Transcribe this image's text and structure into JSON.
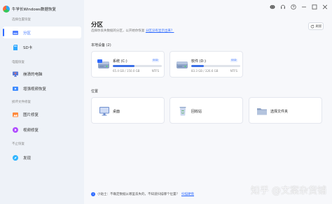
{
  "app": {
    "title": "牛学长Windows数据恢复"
  },
  "sidebar": {
    "sections": [
      {
        "label": "选择位置恢复"
      },
      {
        "label": "电脑恢复"
      },
      {
        "label": "损坏文件修复"
      },
      {
        "label": "不止恢复"
      }
    ],
    "items": [
      {
        "label": "分区",
        "icon": "partition-icon",
        "active": true
      },
      {
        "label": "SD卡",
        "icon": "sd-card-icon"
      },
      {
        "label": "崩溃的电脑",
        "icon": "crashed-pc-icon"
      },
      {
        "label": "增强视频恢复",
        "icon": "video-enhance-icon"
      },
      {
        "label": "图片修复",
        "icon": "photo-repair-icon"
      },
      {
        "label": "视频修复",
        "icon": "video-repair-icon"
      },
      {
        "label": "发现",
        "icon": "discover-icon"
      }
    ]
  },
  "main": {
    "title": "分区",
    "subtitle": "选择你丢失数据的分区，以开始你恢复",
    "subtitle_link": "分区没有显示出来？",
    "refresh_label": "刷新",
    "local_devices_label": "本地设备 (2)",
    "location_label": "位置",
    "disks": [
      {
        "name": "系统 (C:)",
        "tag": "SSD",
        "size": "65.4 GB / 150.0 GB",
        "fs": "NTFS",
        "usage": 0.436
      },
      {
        "name": "软件 (D:)",
        "tag": "SSD",
        "size": "83.3 GB / 326.6 GB",
        "fs": "NTFS",
        "usage": 0.255
      }
    ],
    "locations": [
      {
        "name": "桌面",
        "icon": "desktop-icon"
      },
      {
        "name": "回收站",
        "icon": "recycle-bin-icon"
      },
      {
        "name": "选择文件夹",
        "icon": "folder-icon"
      }
    ],
    "tip": {
      "text": "小贴士：不确定数据从哪里丢失的，不知道扫描哪个位置？",
      "link": "扫描硬盘"
    }
  },
  "watermark": "知乎 @文案杂货铺",
  "colors": {
    "accent": "#2f6bff",
    "sidebar_bg": "#eef2f8",
    "main_bg": "#f7f8fb"
  }
}
